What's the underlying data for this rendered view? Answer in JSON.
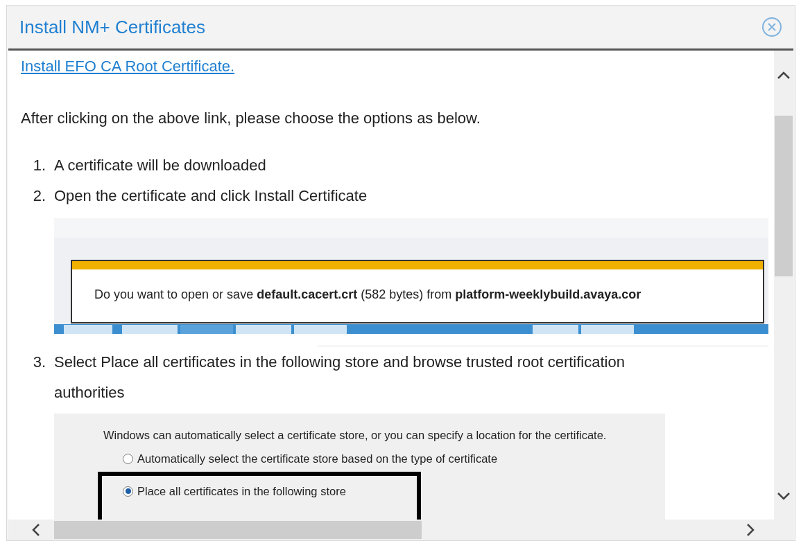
{
  "dialog": {
    "title": "Install NM+ Certificates"
  },
  "link": "Install EFO CA Root Certificate.",
  "intro": "After clicking on the above link, please choose the options as below.",
  "steps": [
    {
      "number": "1.",
      "text": "A certificate will be downloaded"
    },
    {
      "number": "2.",
      "text": "Open the certificate and click Install Certificate",
      "image": {
        "kind": "download-bar",
        "prompt": "Do you want to open or save **default.cacert.crt** (582 bytes) from **platform-weeklybuild.avaya.cor**"
      }
    },
    {
      "number": "3.",
      "text": "Select Place all certificates in the following store and browse trusted root certification authorities",
      "image": {
        "kind": "store-dialog",
        "description": "Windows can automatically select a certificate store, or you can specify a location for the certificate.",
        "options": [
          {
            "label": "Automatically select the certificate store based on the type of certificate",
            "selected": false,
            "highlighted": false
          },
          {
            "label": "Place all certificates in the following store",
            "selected": true,
            "highlighted": true
          }
        ]
      }
    }
  ]
}
